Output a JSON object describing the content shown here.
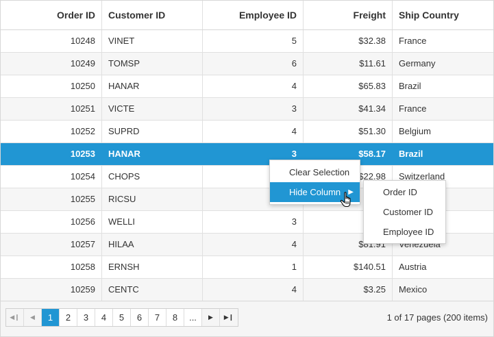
{
  "columns": [
    "Order ID",
    "Customer ID",
    "Employee ID",
    "Freight",
    "Ship Country"
  ],
  "rows": [
    [
      "10248",
      "VINET",
      "5",
      "$32.38",
      "France"
    ],
    [
      "10249",
      "TOMSP",
      "6",
      "$11.61",
      "Germany"
    ],
    [
      "10250",
      "HANAR",
      "4",
      "$65.83",
      "Brazil"
    ],
    [
      "10251",
      "VICTE",
      "3",
      "$41.34",
      "France"
    ],
    [
      "10252",
      "SUPRD",
      "4",
      "$51.30",
      "Belgium"
    ],
    [
      "10253",
      "HANAR",
      "3",
      "$58.17",
      "Brazil"
    ],
    [
      "10254",
      "CHOPS",
      "",
      "$22.98",
      "Switzerland"
    ],
    [
      "10255",
      "RICSU",
      "",
      "",
      ""
    ],
    [
      "10256",
      "WELLI",
      "3",
      "",
      ""
    ],
    [
      "10257",
      "HILAA",
      "4",
      "$81.91",
      "Venezuela"
    ],
    [
      "10258",
      "ERNSH",
      "1",
      "$140.51",
      "Austria"
    ],
    [
      "10259",
      "CENTC",
      "4",
      "$3.25",
      "Mexico"
    ]
  ],
  "selected_row": 5,
  "context_menu": {
    "items": [
      "Clear Selection",
      "Hide Column"
    ],
    "hovered": "Hide Column",
    "submenu": [
      "Order ID",
      "Customer ID",
      "Employee ID"
    ]
  },
  "pager": {
    "pages": [
      "1",
      "2",
      "3",
      "4",
      "5",
      "6",
      "7",
      "8",
      "..."
    ],
    "current_page": "1",
    "info": "1 of 17 pages (200 items)"
  },
  "icons": {
    "first": "first-page-icon",
    "prev": "prev-page-icon",
    "next": "next-page-icon",
    "last": "last-page-icon",
    "submenu_arrow": "caret-right-icon",
    "cursor": "hand-pointer-icon"
  },
  "colors": {
    "accent": "#2196d3",
    "alt_row": "#f6f6f6",
    "border": "#e0e0e0"
  }
}
